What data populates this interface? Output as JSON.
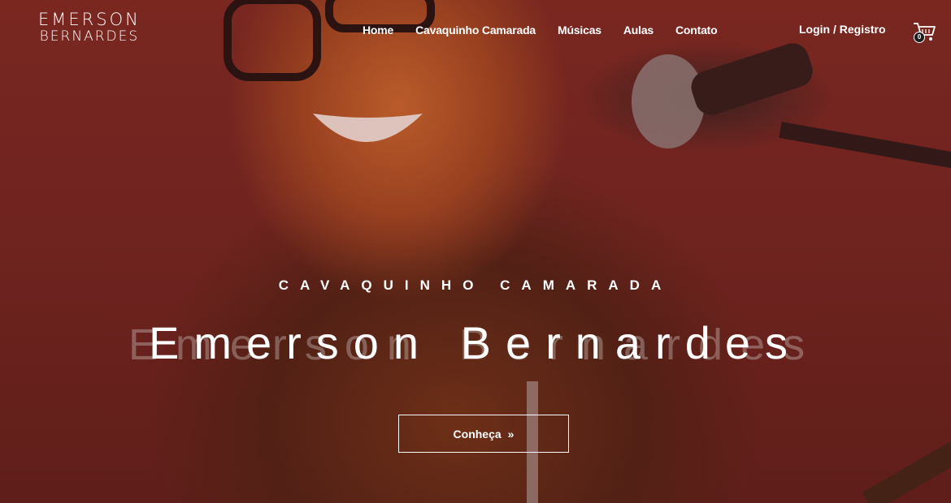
{
  "logo": {
    "line1": "EMERSON",
    "line2": "BERNARDES"
  },
  "nav": {
    "items": [
      {
        "label": "Home"
      },
      {
        "label": "Cavaquinho Camarada"
      },
      {
        "label": "Músicas"
      },
      {
        "label": "Aulas"
      },
      {
        "label": "Contato"
      }
    ],
    "login": "Login / Registro",
    "cart_count": "0"
  },
  "hero": {
    "subtitle": "CAVAQUINHO CAMARADA",
    "title": "Emerson Bernardes",
    "title_shadow": "Emerson Bernardes",
    "cta_label": "Conheça",
    "cta_icon": "double-chevron-right-icon"
  },
  "colors": {
    "background": "#6e2620",
    "text": "#ffffff"
  }
}
